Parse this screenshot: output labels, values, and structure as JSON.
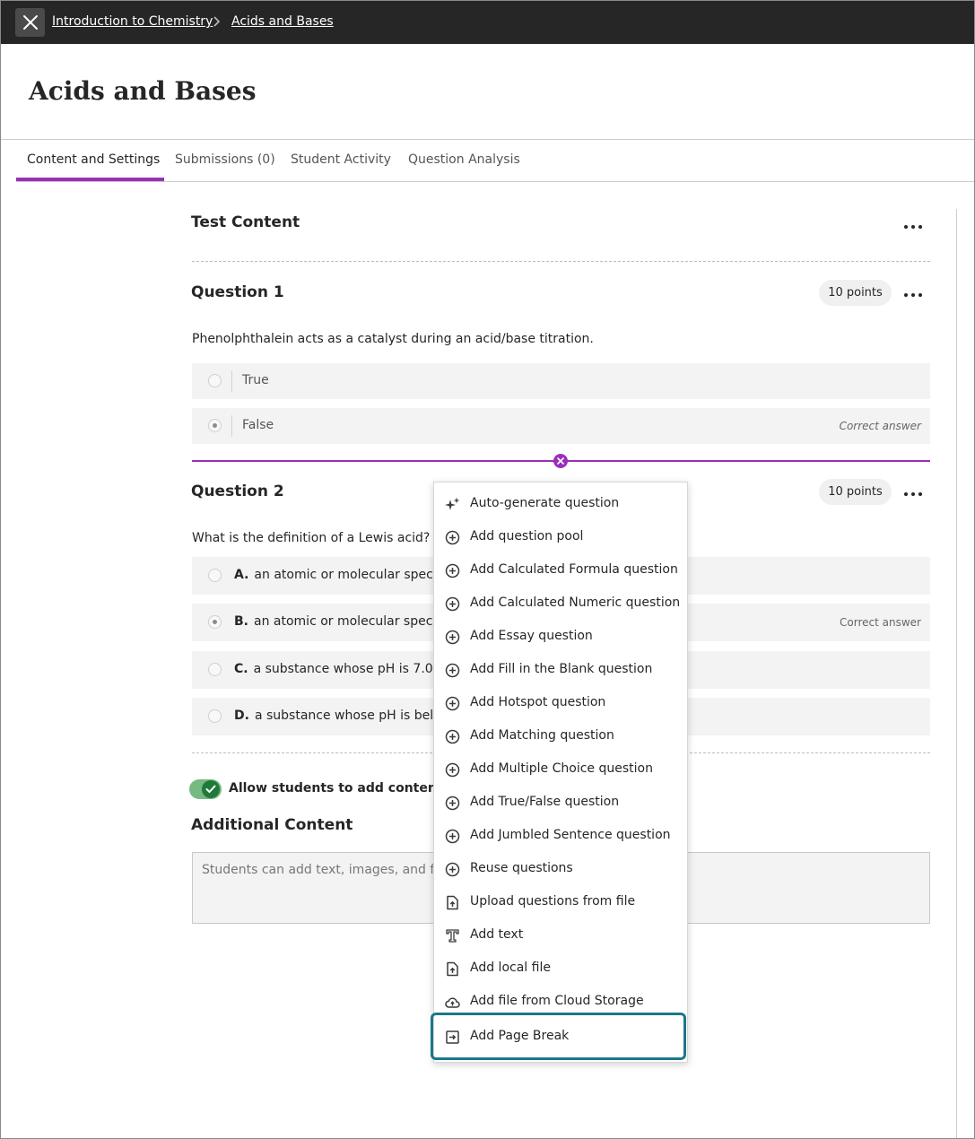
{
  "breadcrumb": {
    "course": "Introduction to Chemistry",
    "current": "Acids and Bases"
  },
  "page": {
    "title": "Acids and Bases"
  },
  "tabs": [
    {
      "label": "Content and Settings",
      "active": true
    },
    {
      "label": "Submissions (0)",
      "active": false
    },
    {
      "label": "Student Activity",
      "active": false
    },
    {
      "label": "Question Analysis",
      "active": false
    }
  ],
  "test_content": {
    "heading": "Test Content"
  },
  "question1": {
    "title": "Question 1",
    "points": "10 points",
    "text": "Phenolphthalein acts as a catalyst during an acid/base titration.",
    "answers": [
      {
        "label": "True",
        "checked": false,
        "correct_label": ""
      },
      {
        "label": "False",
        "checked": true,
        "correct_label": "Correct answer"
      }
    ]
  },
  "question2": {
    "title": "Question 2",
    "points": "10 points",
    "text": "What is the definition of a Lewis acid?",
    "answers": [
      {
        "letter": "A.",
        "label": "an atomic or molecular species",
        "checked": false,
        "correct_label": ""
      },
      {
        "letter": "B.",
        "label": "an atomic or molecular species",
        "checked": true,
        "correct_label": "Correct answer"
      },
      {
        "letter": "C.",
        "label": "a substance whose pH is 7.0",
        "checked": false,
        "correct_label": ""
      },
      {
        "letter": "D.",
        "label": "a substance whose pH is below",
        "checked": false,
        "correct_label": ""
      }
    ]
  },
  "allow_toggle": {
    "label": "Allow students to add content at e",
    "on": true
  },
  "additional_content": {
    "heading": "Additional Content",
    "placeholder": "Students can add text, images, and files"
  },
  "menu": {
    "items": [
      {
        "label": "Auto-generate question",
        "icon": "sparkle-icon"
      },
      {
        "label": "Add question pool",
        "icon": "plus-circle-icon"
      },
      {
        "label": "Add Calculated Formula question",
        "icon": "plus-circle-icon"
      },
      {
        "label": "Add Calculated Numeric question",
        "icon": "plus-circle-icon"
      },
      {
        "label": "Add Essay question",
        "icon": "plus-circle-icon"
      },
      {
        "label": "Add Fill in the Blank question",
        "icon": "plus-circle-icon"
      },
      {
        "label": "Add Hotspot question",
        "icon": "plus-circle-icon"
      },
      {
        "label": "Add Matching question",
        "icon": "plus-circle-icon"
      },
      {
        "label": "Add Multiple Choice question",
        "icon": "plus-circle-icon"
      },
      {
        "label": "Add True/False question",
        "icon": "plus-circle-icon"
      },
      {
        "label": "Add Jumbled Sentence question",
        "icon": "plus-circle-icon"
      },
      {
        "label": "Reuse questions",
        "icon": "plus-circle-icon"
      },
      {
        "label": "Upload questions from file",
        "icon": "file-upload-icon"
      },
      {
        "label": "Add text",
        "icon": "text-icon"
      },
      {
        "label": "Add local file",
        "icon": "file-upload-icon"
      },
      {
        "label": "Add file from Cloud Storage",
        "icon": "cloud-upload-icon"
      },
      {
        "label": "Add Page Break",
        "icon": "page-break-icon",
        "highlighted": true
      }
    ]
  },
  "colors": {
    "accent": "#9a2fba",
    "highlight": "#1a7889",
    "topbar": "#262626",
    "toggle_on": "#1f7a39"
  }
}
